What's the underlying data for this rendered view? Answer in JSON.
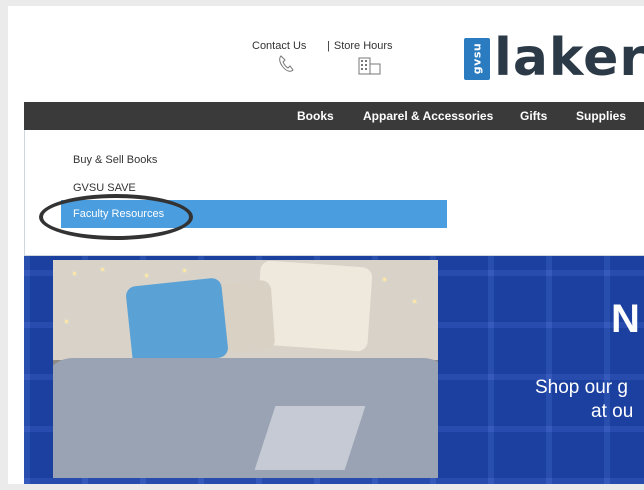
{
  "header": {
    "contact_label": "Contact Us",
    "store_hours_label": "Store Hours",
    "contact_icon": "phone-icon",
    "store_hours_icon": "building-icon",
    "logo": {
      "badge_text": "gvsu",
      "word": "laker",
      "badge_color": "#2a7bbf",
      "word_color": "#2c3a47"
    }
  },
  "nav": {
    "items": [
      {
        "label": "Books"
      },
      {
        "label": "Apparel & Accessories"
      },
      {
        "label": "Gifts"
      },
      {
        "label": "Supplies"
      }
    ],
    "background": "#3a3a3a"
  },
  "dropdown": {
    "items": [
      {
        "label": "Buy & Sell Books"
      },
      {
        "label": "GVSU SAVE"
      },
      {
        "label": "Faculty Resources",
        "highlighted": true
      }
    ],
    "highlight_color": "#4a9ddf"
  },
  "hero": {
    "title": "N",
    "subtitle_line1": "Shop our g",
    "subtitle_line2": "at ou",
    "background": "#1f48b4"
  }
}
